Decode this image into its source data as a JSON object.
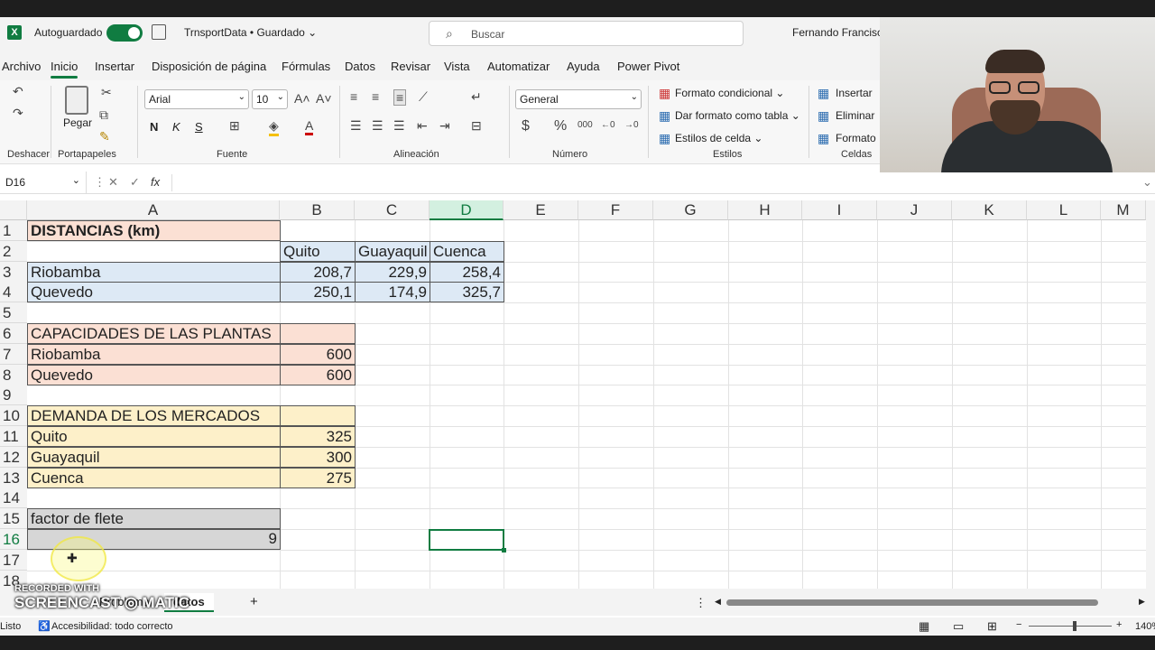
{
  "titlebar": {
    "app_icon": "X",
    "autosave_label": "Autoguardado",
    "doc_title": "TrnsportData • Guardado ⌄",
    "search_placeholder": "Buscar",
    "user_name": "Fernando Francisco"
  },
  "menu": [
    "Archivo",
    "Inicio",
    "Insertar",
    "Disposición de página",
    "Fórmulas",
    "Datos",
    "Revisar",
    "Vista",
    "Automatizar",
    "Ayuda",
    "Power Pivot"
  ],
  "ribbon": {
    "groups": [
      "Deshacer",
      "Portapapeles",
      "Fuente",
      "Alineación",
      "Número",
      "Estilos",
      "Celdas"
    ],
    "paste_label": "Pegar",
    "font_name": "Arial",
    "font_size": "10",
    "number_format": "General",
    "cond_format": "Formato condicional ⌄",
    "format_table": "Dar formato como tabla ⌄",
    "cell_styles": "Estilos de celda ⌄",
    "insert": "Insertar",
    "delete": "Eliminar",
    "format": "Formato ⌄",
    "bold": "N",
    "italic": "K",
    "underline": "S"
  },
  "formula_bar": {
    "name_box": "D16",
    "fx": "fx",
    "formula": ""
  },
  "columns": [
    "A",
    "B",
    "C",
    "D",
    "E",
    "F",
    "G",
    "H",
    "I",
    "J",
    "K",
    "L",
    "M"
  ],
  "rows": [
    "1",
    "2",
    "3",
    "4",
    "5",
    "6",
    "7",
    "8",
    "9",
    "10",
    "11",
    "12",
    "13",
    "14",
    "15",
    "16",
    "17",
    "18"
  ],
  "cells": {
    "A1": "DISTANCIAS (km)",
    "B2": "Quito",
    "C2": "Guayaquil",
    "D2": "Cuenca",
    "A3": "Riobamba",
    "B3": "208,7",
    "C3": "229,9",
    "D3": "258,4",
    "A4": "Quevedo",
    "B4": "250,1",
    "C4": "174,9",
    "D4": "325,7",
    "A6": "CAPACIDADES DE LAS PLANTAS",
    "A7": "Riobamba",
    "B7": "600",
    "A8": "Quevedo",
    "B8": "600",
    "A10": "DEMANDA DE LOS MERCADOS",
    "A11": "Quito",
    "B11": "325",
    "A12": "Guayaquil",
    "B12": "300",
    "A13": "Cuenca",
    "B13": "275",
    "A15": "factor de flete",
    "B16": "9"
  },
  "sheets": [
    "Problema",
    "datos"
  ],
  "add_sheet": "+",
  "status": {
    "ready": "Listo",
    "accessibility": "Accesibilidad: todo correcto",
    "zoom": "140%"
  },
  "watermark": {
    "line1": "RECORDED WITH",
    "line2": "SCREENCAST ◎ MATIC"
  },
  "colors": {
    "accent": "#107c41",
    "salmon": "#fbe0d4",
    "blue": "#dde9f5",
    "yellow": "#fdf0c9",
    "gray": "#d6d6d6"
  }
}
